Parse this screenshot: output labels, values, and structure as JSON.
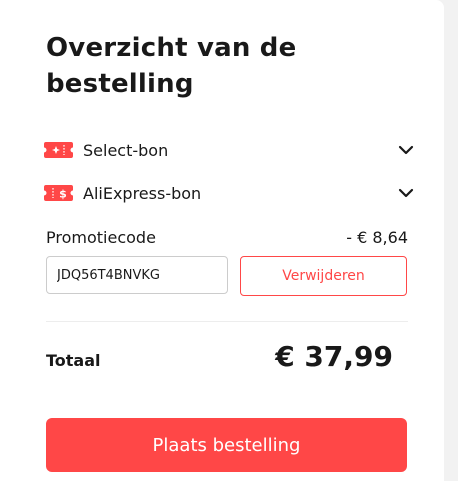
{
  "summary": {
    "title": "Overzicht van de bestelling",
    "coupons": [
      {
        "label": "Select-bon",
        "icon": "select-coupon-icon"
      },
      {
        "label": "AliExpress-bon",
        "icon": "aliexpress-coupon-icon"
      }
    ],
    "promo": {
      "label": "Promotiecode",
      "discount": "- € 8,64",
      "code_value": "JDQ56T4BNVKG",
      "remove_label": "Verwijderen"
    },
    "total": {
      "label": "Totaal",
      "value": "€ 37,99"
    },
    "place_order_label": "Plaats bestelling"
  },
  "colors": {
    "accent": "#ff4747",
    "text": "#191919",
    "border": "#cccccc",
    "background": "#f2f2f2"
  }
}
